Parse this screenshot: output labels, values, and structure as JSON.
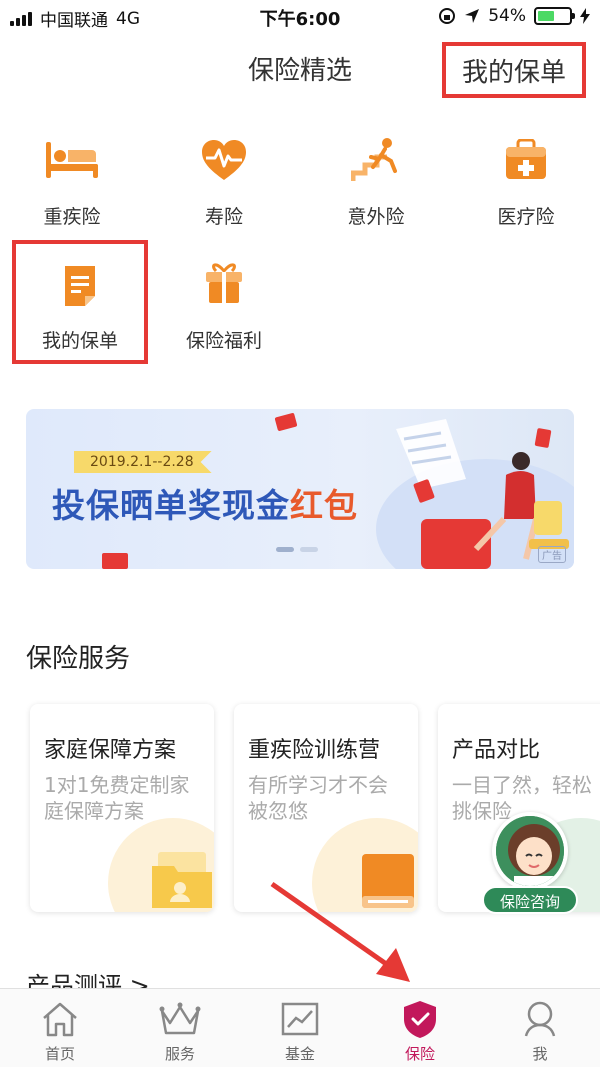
{
  "status_bar": {
    "carrier": "中国联通",
    "network": "4G",
    "time": "下午6:00",
    "battery_percent": "54%",
    "battery_level": 0.54
  },
  "header": {
    "title": "保险精选",
    "my_policy_link": "我的保单"
  },
  "categories": [
    {
      "label": "重疾险",
      "icon": "hospital-bed-icon"
    },
    {
      "label": "寿险",
      "icon": "heartbeat-icon"
    },
    {
      "label": "意外险",
      "icon": "stairs-fall-icon"
    },
    {
      "label": "医疗险",
      "icon": "medical-kit-icon"
    },
    {
      "label": "我的保单",
      "icon": "document-icon"
    },
    {
      "label": "保险福利",
      "icon": "gift-icon"
    }
  ],
  "banner": {
    "date_range": "2019.2.1--2.28",
    "headline_main": "投保晒单奖现金",
    "headline_accent": "红包",
    "ad_tag": "广告"
  },
  "services": {
    "title": "保险服务",
    "cards": [
      {
        "title": "家庭保障方案",
        "desc": "1对1免费定制家庭保障方案"
      },
      {
        "title": "重疾险训练营",
        "desc": "有所学习才不会被忽悠"
      },
      {
        "title": "产品对比",
        "desc": "一目了然，轻松挑保险"
      }
    ]
  },
  "next_section_title": "产品测评 >",
  "consult": {
    "label": "保险咨询"
  },
  "tabbar": [
    {
      "label": "首页",
      "icon": "home-icon"
    },
    {
      "label": "服务",
      "icon": "crown-icon"
    },
    {
      "label": "基金",
      "icon": "chart-icon"
    },
    {
      "label": "保险",
      "icon": "shield-check-icon",
      "active": true
    },
    {
      "label": "我",
      "icon": "user-icon"
    }
  ],
  "colors": {
    "accent_orange": "#f08a24",
    "highlight_red": "#e53935",
    "active_tab": "#c2185b"
  }
}
